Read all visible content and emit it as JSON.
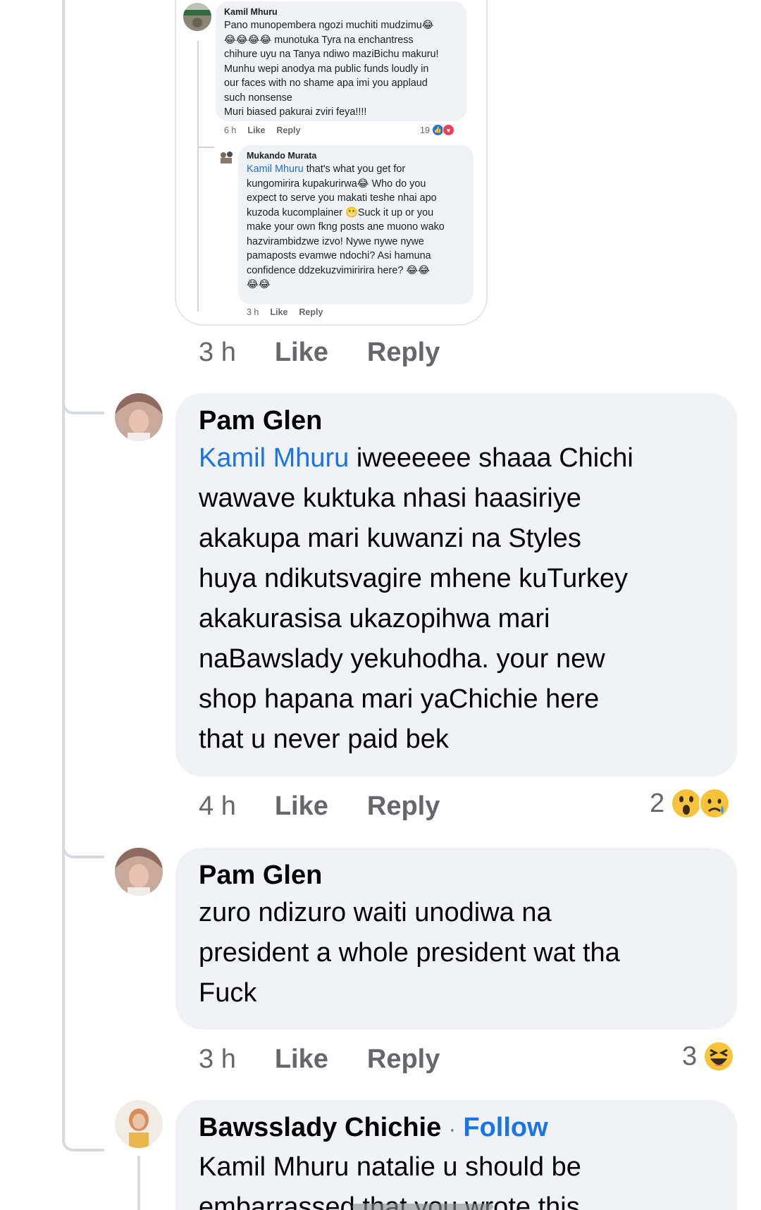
{
  "embedded": {
    "comment1": {
      "author": "Kamil Mhuru",
      "lines": [
        "Pano munopembera ngozi muchiti mudzimu",
        "munotuka Tyra na enchantress",
        "chihure uyu na Tanya ndiwo maziBichu makuru!",
        "Munhu wepi anodya ma public funds loudly in",
        "our faces with no shame apa imi you applaud",
        "such nonsense",
        "Muri biased pakurai zviri feya!!!!"
      ],
      "time": "6 h",
      "like": "Like",
      "reply": "Reply",
      "reaction_count": "19"
    },
    "comment2": {
      "author": "Mukando Murata",
      "mention": "Kamil Mhuru",
      "lines": [
        "that's what you get for",
        "kungomirira kupakurirwa",
        "Who do you",
        "expect to serve you makati teshe nhai apo",
        "kuzoda kucomplainer",
        "Suck it up or you",
        "make your own fkng posts ane muono wako",
        "hazvirambidzwe izvo! Nywe nywe nywe",
        "pamaposts evamwe ndochi? Asi hamuna",
        "confidence ddzekuzvimiririra here?"
      ],
      "time": "3 h",
      "like": "Like",
      "reply": "Reply"
    },
    "meta": {
      "time": "3 h",
      "like": "Like",
      "reply": "Reply"
    }
  },
  "comments": [
    {
      "author": "Pam Glen",
      "mention": "Kamil Mhuru",
      "text_lines": [
        "iweeeeee shaaa Chichi",
        "wawave kuktuka nhasi haasiriye",
        "akakupa mari kuwanzi na Styles",
        "huya ndikutsvagire mhene kuTurkey",
        "akakurasisa ukazopihwa mari",
        "naBawslady yekuhodha. your new",
        "shop hapana mari yaChichie here",
        "that u never paid bek"
      ],
      "time": "4 h",
      "like": "Like",
      "reply": "Reply",
      "reaction_count": "2"
    },
    {
      "author": "Pam Glen",
      "text_lines": [
        "zuro ndizuro waiti unodiwa na",
        "president a whole president wat tha",
        "Fuck"
      ],
      "time": "3 h",
      "like": "Like",
      "reply": "Reply",
      "reaction_count": "3"
    },
    {
      "author": "Bawsslady Chichie",
      "separator": "·",
      "follow": "Follow",
      "text_lines": [
        "Kamil Mhuru natalie u should be",
        "embarrassed that you wrote this"
      ]
    }
  ],
  "colors": {
    "bubble": "#f0f2f5",
    "link": "#1b74e4",
    "meta": "#65676b",
    "thread": "#d7dadf"
  },
  "icons": [
    "like-reaction-icon",
    "love-reaction-icon",
    "laugh-emoji-icon",
    "wow-reaction-icon",
    "sad-reaction-icon",
    "haha-reaction-icon",
    "grimace-emoji-icon"
  ]
}
